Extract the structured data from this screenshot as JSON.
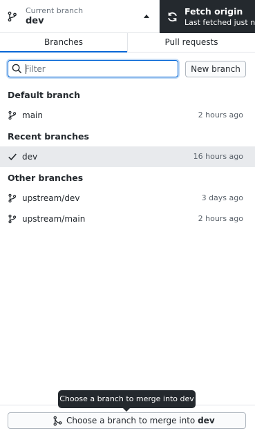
{
  "toolbar": {
    "current_branch": {
      "description": "Current branch",
      "title": "dev",
      "icon": "git-branch-icon"
    },
    "fetch": {
      "title": "Fetch origin",
      "description": "Last fetched just now",
      "icon": "sync-icon"
    }
  },
  "tabs": [
    {
      "label": "Branches",
      "selected": true
    },
    {
      "label": "Pull requests",
      "selected": false
    }
  ],
  "filter": {
    "value": "",
    "placeholder": "Filter",
    "icon": "search-icon"
  },
  "new_branch_label": "New branch",
  "sections": {
    "default": {
      "header": "Default branch",
      "items": [
        {
          "name": "main",
          "time": "2 hours ago"
        }
      ]
    },
    "recent": {
      "header": "Recent branches",
      "items": [
        {
          "name": "dev",
          "time": "16 hours ago",
          "selected": true
        }
      ]
    },
    "other": {
      "header": "Other branches",
      "items": [
        {
          "name": "upstream/dev",
          "time": "3 days ago"
        },
        {
          "name": "upstream/main",
          "time": "2 hours ago"
        }
      ]
    }
  },
  "merge": {
    "label_prefix": "Choose a branch to merge into ",
    "branch": "dev",
    "tooltip": "Choose a branch to merge into dev",
    "icon": "git-merge-icon"
  },
  "colors": {
    "accent": "#0366d6",
    "dark": "#24292e",
    "selected_row": "#e8eaed"
  }
}
